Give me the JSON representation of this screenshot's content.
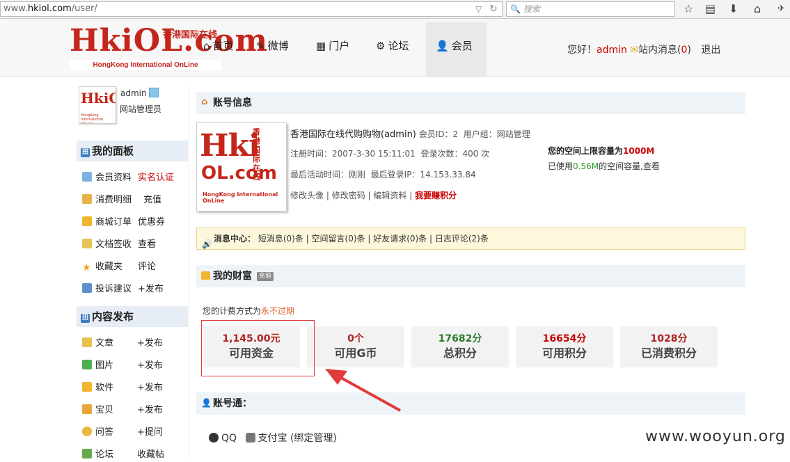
{
  "browser": {
    "url_prefix": "www.",
    "url_domain": "hkiol.com",
    "url_path": "/user/",
    "search_placeholder": "搜索"
  },
  "header": {
    "logo_text": "HkiOL.com",
    "logo_cn": "香港国际在线",
    "logo_en": "HongKong International OnLine",
    "nav": [
      {
        "label": "首页",
        "icon": "home-icon"
      },
      {
        "label": "微博",
        "icon": "pencil-icon"
      },
      {
        "label": "门户",
        "icon": "grid-icon"
      },
      {
        "label": "论坛",
        "icon": "gear-icon"
      },
      {
        "label": "会员",
        "icon": "user-icon",
        "active": true
      }
    ],
    "greeting": "您好！",
    "username": "admin",
    "inbox_label": "站内消息(",
    "inbox_count": "0",
    "inbox_close": ")",
    "logout": "退出"
  },
  "sidebar": {
    "username": "admin",
    "role": "网站管理员",
    "panel_title": "我的面板",
    "panel_items": [
      {
        "label": "会员资料",
        "extra": "实名认证",
        "extra_red": true
      },
      {
        "label": "消费明细",
        "extra": "充值"
      },
      {
        "label": "商城订单",
        "extra": "优惠券"
      },
      {
        "label": "文档签收",
        "extra": "查看"
      },
      {
        "label": "收藏夹",
        "extra": "评论"
      },
      {
        "label": "投诉建议",
        "extra": "+发布"
      }
    ],
    "publish_title": "内容发布",
    "publish_items": [
      {
        "label": "文章",
        "extra": "+发布"
      },
      {
        "label": "图片",
        "extra": "+发布"
      },
      {
        "label": "软件",
        "extra": "+发布"
      },
      {
        "label": "宝贝",
        "extra": "+发布"
      },
      {
        "label": "问答",
        "extra": "+提问"
      },
      {
        "label": "论坛",
        "extra": "收藏帖"
      }
    ]
  },
  "account": {
    "title": "账号信息",
    "name": "香港国际在线代购购物(admin)",
    "member_id": "会员ID：2",
    "group": "用户组：网站管理",
    "register": "注册时间：2007-3-30 15:11:01",
    "login_count": "登录次数：400 次",
    "last_active": "最后活动时间：刚刚",
    "last_ip": "最后登录IP：14.153.33.84",
    "links": [
      "修改头像",
      "修改密码",
      "编辑资料"
    ],
    "earn_link": "我要赚积分",
    "space_label": "您的空间上限容量为",
    "space_value": "1000M",
    "used_prefix": "已使用",
    "used_value": "0.56M",
    "used_suffix": "的空间容量,查看"
  },
  "messages": {
    "label": "消息中心：",
    "items": [
      "短消息(0)条",
      "空间留言(0)条",
      "好友请求(0)条",
      "日志评论(2)条"
    ]
  },
  "wealth": {
    "title": "我的财富",
    "recharge_badge": "充值",
    "billing_prefix": "您的计费方式为",
    "billing_value": "永不过期",
    "cards": [
      {
        "value": "1,145.00元",
        "label": "可用资金",
        "color": "#b22222"
      },
      {
        "value": "0个",
        "label": "可用G币",
        "color": "#b22222"
      },
      {
        "value": "17682分",
        "label": "总积分",
        "color": "#2a7a2a"
      },
      {
        "value": "16654分",
        "label": "可用积分",
        "color": "#cc0000"
      },
      {
        "value": "1028分",
        "label": "已消费积分",
        "color": "#b22222"
      }
    ]
  },
  "passport": {
    "title": "账号通：",
    "qq": "QQ",
    "alipay": "支付宝 (绑定管理)"
  },
  "watermark": "www.wooyun.org"
}
